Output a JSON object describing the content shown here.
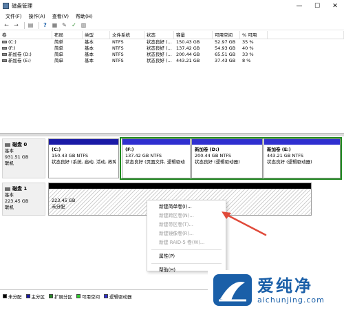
{
  "window": {
    "title": "磁盘管理",
    "controls": [
      "—",
      "☐",
      "✕"
    ]
  },
  "menu": [
    "文件(F)",
    "操作(A)",
    "查看(V)",
    "帮助(H)"
  ],
  "toolbar": {
    "buttons": [
      "back-arrow-icon",
      "forward-arrow-icon",
      "disk-list-icon",
      "help-icon",
      "properties-icon",
      "settings-icon",
      "refresh-icon",
      "check-icon",
      "grid-icon"
    ]
  },
  "volume_table": {
    "headers": [
      "卷",
      "布局",
      "类型",
      "文件系统",
      "状态",
      "容量",
      "可用空间",
      "% 可用"
    ],
    "rows": [
      [
        "(C:)",
        "简单",
        "基本",
        "NTFS",
        "状态良好 (...",
        "150.43 GB",
        "52.97 GB",
        "35 %"
      ],
      [
        "(F:)",
        "简单",
        "基本",
        "NTFS",
        "状态良好 (...",
        "137.42 GB",
        "54.93 GB",
        "40 %"
      ],
      [
        "新加卷 (D:)",
        "简单",
        "基本",
        "NTFS",
        "状态良好 (...",
        "200.44 GB",
        "65.51 GB",
        "33 %"
      ],
      [
        "新加卷 (E:)",
        "简单",
        "基本",
        "NTFS",
        "状态良好 (...",
        "443.21 GB",
        "37.43 GB",
        "8 %"
      ]
    ]
  },
  "disk0": {
    "name": "磁盘 0",
    "type": "基本",
    "size": "931.51 GB",
    "status": "联机",
    "partitions": [
      {
        "name": "(C:)",
        "size": "150.43 GB NTFS",
        "status": "状态良好 (系统, 启动, 活动, 故障"
      },
      {
        "name": "(F:)",
        "size": "137.42 GB NTFS",
        "status": "状态良好 (页面文件, 逻辑驱动"
      },
      {
        "name": "新加卷 (D:)",
        "size": "200.44 GB NTFS",
        "status": "状态良好 (逻辑驱动器)"
      },
      {
        "name": "新加卷 (E:)",
        "size": "443.21 GB NTFS",
        "status": "状态良好 (逻辑驱动器)"
      }
    ]
  },
  "disk1": {
    "name": "磁盘 1",
    "type": "基本",
    "size": "223.45 GB",
    "status": "联机",
    "unallocated": {
      "size": "223.45 GB",
      "label": "未分配"
    }
  },
  "context_menu": {
    "items": [
      {
        "label": "新建简单卷(I)...",
        "enabled": true
      },
      {
        "label": "新建跨区卷(N)...",
        "enabled": false
      },
      {
        "label": "新建带区卷(T)...",
        "enabled": false
      },
      {
        "label": "新建镜像卷(R)...",
        "enabled": false
      },
      {
        "label": "新建 RAID-5 卷(W)...",
        "enabled": false
      },
      {
        "label": "属性(P)",
        "enabled": true
      },
      {
        "label": "帮助(H)",
        "enabled": true
      }
    ]
  },
  "legend": [
    {
      "label": "未分配",
      "color": "#000000"
    },
    {
      "label": "主分区",
      "color": "#1a1aa6"
    },
    {
      "label": "扩展分区",
      "color": "#2a8a2a"
    },
    {
      "label": "可用空间",
      "color": "#33cc33"
    },
    {
      "label": "逻辑驱动器",
      "color": "#2f2fd0"
    }
  ],
  "watermark": {
    "cn": "爱纯净",
    "url": "aichunjing.com"
  },
  "colors": {
    "primary_partition": "#1a1aa6",
    "extended_frame": "#1f8a1f",
    "arrow": "#e04a3a",
    "watermark": "#1a5fa8"
  }
}
